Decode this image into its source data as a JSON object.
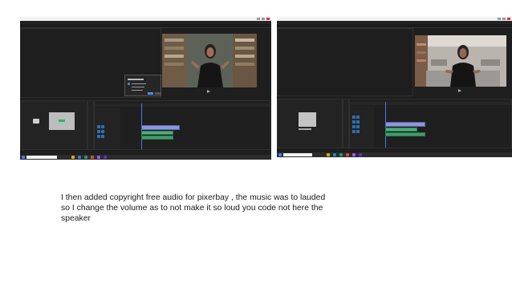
{
  "caption": {
    "line1": "I then added copyright free audio for pixerbay , the music was to lauded",
    "line2": "so I change the volume as to not make it so loud you code not here the",
    "line3": "speaker"
  },
  "colors": {
    "app_bg": "#1e1e1e",
    "video_clip": "#8e97d8",
    "audio_clip": "#4fae7b",
    "playhead": "#3b7bff"
  },
  "icons": [
    "minimize-icon",
    "maximize-icon",
    "close-icon",
    "windows-start-icon",
    "folder-icon",
    "play-icon"
  ]
}
